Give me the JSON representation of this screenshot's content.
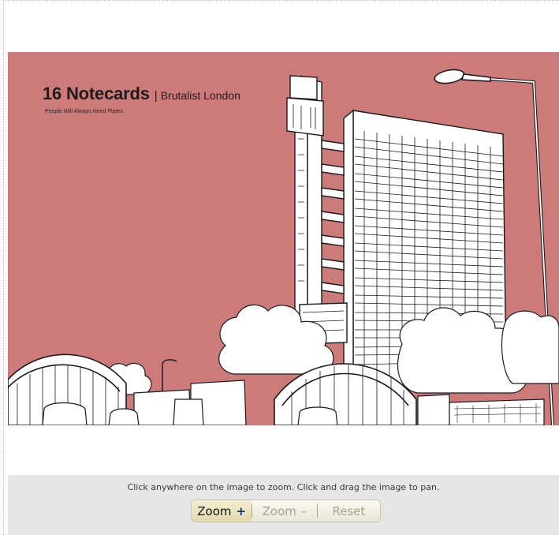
{
  "card": {
    "title": "16 Notecards",
    "separator": "|",
    "subtitle": "Brutalist London",
    "credit": "People Will Always Need Plates"
  },
  "colors": {
    "card_background": "#cc7a7a",
    "line_art": "#1a1a1a",
    "controls_bar": "#e6e6e6"
  },
  "controls": {
    "hint": "Click anywhere on the image to zoom. Click and drag the image to pan.",
    "zoom_in_label": "Zoom",
    "zoom_in_glyph": "+",
    "zoom_out_label": "Zoom",
    "zoom_out_glyph": "–",
    "reset_label": "Reset",
    "zoom_in_enabled": true,
    "zoom_out_enabled": false,
    "reset_enabled": false
  }
}
